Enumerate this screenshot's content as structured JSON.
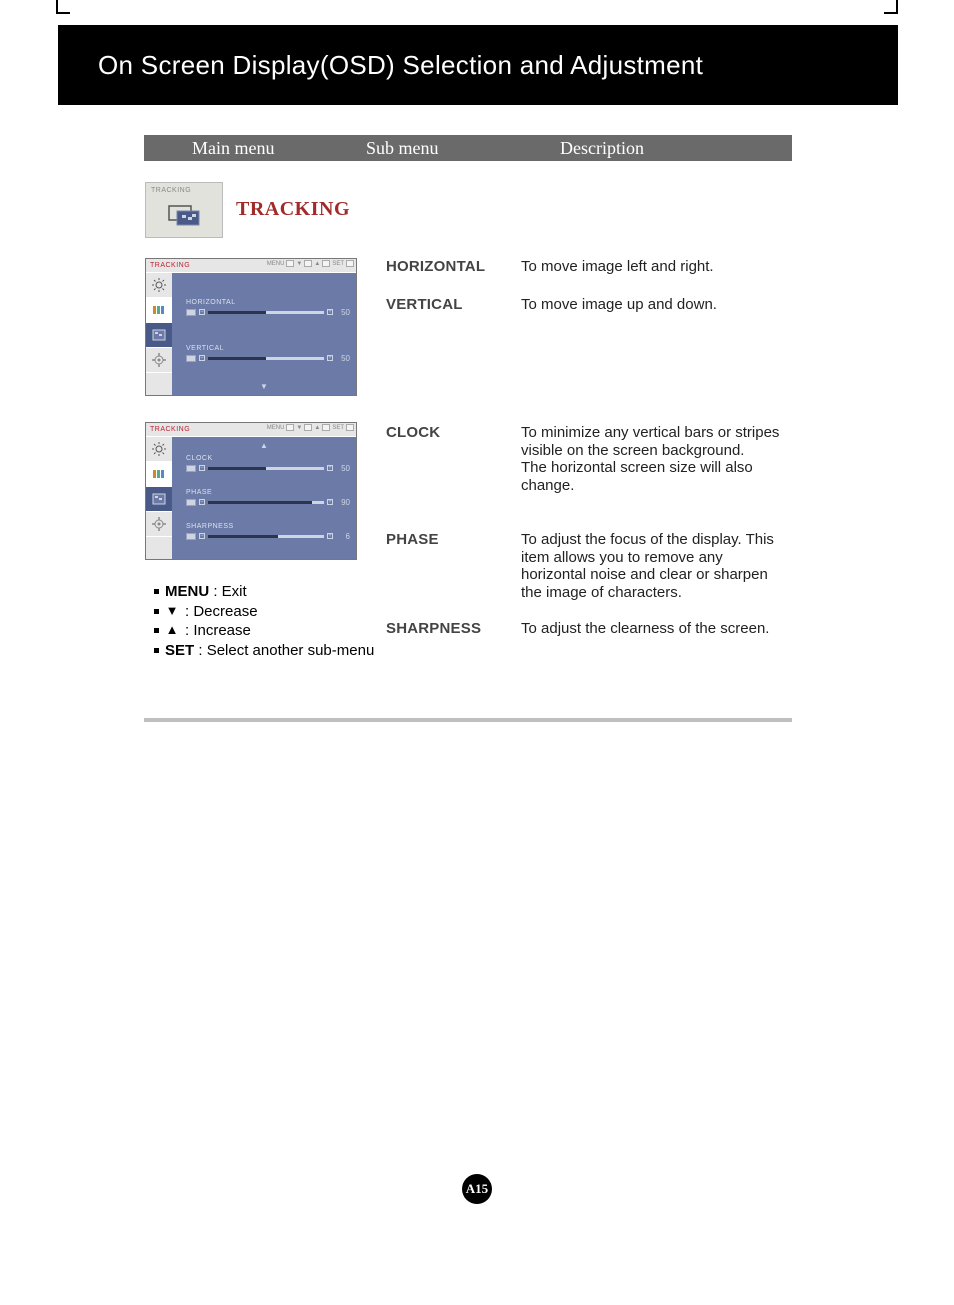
{
  "header": {
    "title": "On Screen Display(OSD) Selection and Adjustment"
  },
  "columns": {
    "main": "Main menu",
    "sub": "Sub menu",
    "desc": "Description"
  },
  "tracking": {
    "badge": "TRACKING",
    "title": "TRACKING"
  },
  "osd1": {
    "title": "TRACKING",
    "nav": {
      "menu": "MENU",
      "set": "SET"
    },
    "rows": {
      "horizontal": {
        "label": "HORIZONTAL",
        "value": "50"
      },
      "vertical": {
        "label": "VERTICAL",
        "value": "50"
      }
    }
  },
  "osd2": {
    "title": "TRACKING",
    "nav": {
      "menu": "MENU",
      "set": "SET"
    },
    "rows": {
      "clock": {
        "label": "CLOCK",
        "value": "50"
      },
      "phase": {
        "label": "PHASE",
        "value": "90"
      },
      "sharpness": {
        "label": "SHARPNESS",
        "value": "6"
      }
    }
  },
  "items": {
    "horizontal": {
      "name": "HORIZONTAL",
      "desc": "To move image left and right."
    },
    "vertical": {
      "name": "VERTICAL",
      "desc": "To move image up and down."
    },
    "clock": {
      "name": "CLOCK",
      "desc": "To minimize any vertical bars or stripes visible on the screen background.\nThe horizontal screen size will also change."
    },
    "phase": {
      "name": "PHASE",
      "desc": "To adjust the focus of the display. This item allows you to remove any horizontal noise and clear or sharpen the image of characters."
    },
    "sharpness": {
      "name": "SHARPNESS",
      "desc": "To adjust the clearness of the screen."
    }
  },
  "legend": {
    "menu_b": "MENU",
    "menu_t": " : Exit",
    "dec": " : Decrease",
    "inc": " : Increase",
    "set_b": "SET",
    "set_t": " : Select another sub-menu"
  },
  "page": "A15"
}
